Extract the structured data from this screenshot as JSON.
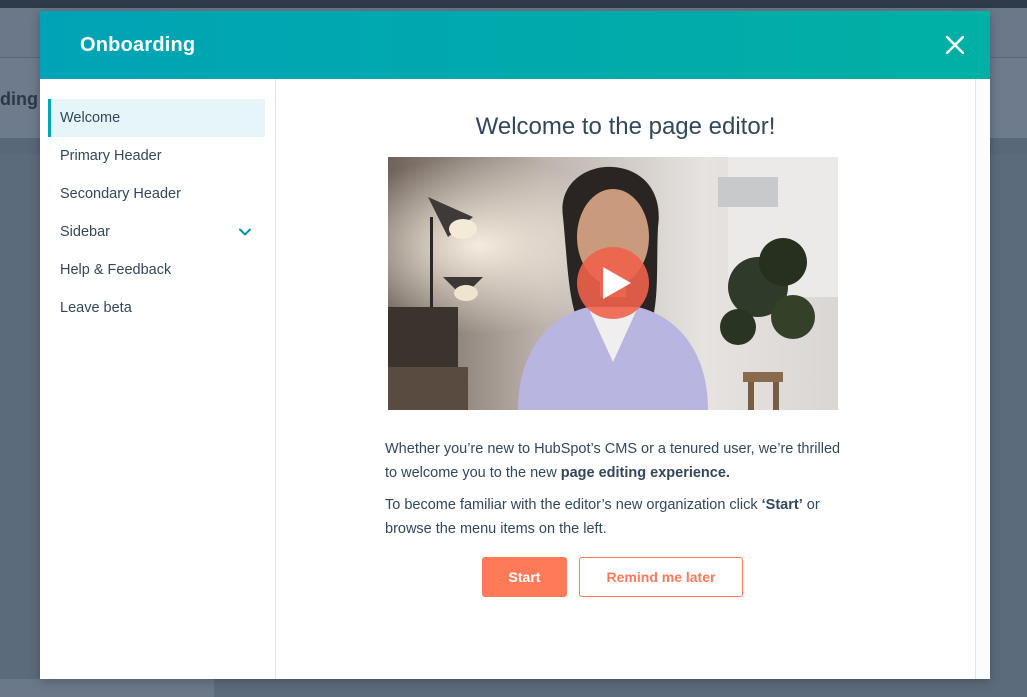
{
  "background": {
    "heading_fragment": "ding p"
  },
  "modal": {
    "title": "Onboarding",
    "close_icon": "close-icon"
  },
  "sidebar": {
    "items": [
      {
        "label": "Welcome",
        "active": true
      },
      {
        "label": "Primary Header"
      },
      {
        "label": "Secondary Header"
      },
      {
        "label": "Sidebar",
        "has_chevron": true,
        "chevron_icon": "chevron-down-icon"
      },
      {
        "label": "Help & Feedback"
      },
      {
        "label": "Leave beta"
      }
    ]
  },
  "main": {
    "title": "Welcome to the page editor!",
    "video": {
      "play_icon": "play-icon"
    },
    "p1_text": "Whether you’re new to HubSpot’s CMS or a tenured user, we’re thrilled to welcome you to the new ",
    "p1_bold": "page editing experience.",
    "p2_text": "To become familiar with the editor’s new organization click ",
    "p2_bold": "‘Start’",
    "p2_tail": " or browse the menu items on the left.",
    "start_label": "Start",
    "remind_label": "Remind me later"
  },
  "colors": {
    "header_gradient_start": "#00a3b5",
    "header_gradient_end": "#00b0a4",
    "accent_orange": "#ff7a59",
    "active_nav_bg": "#e5f5f8",
    "active_nav_border": "#00a4bd",
    "text": "#33475b"
  }
}
